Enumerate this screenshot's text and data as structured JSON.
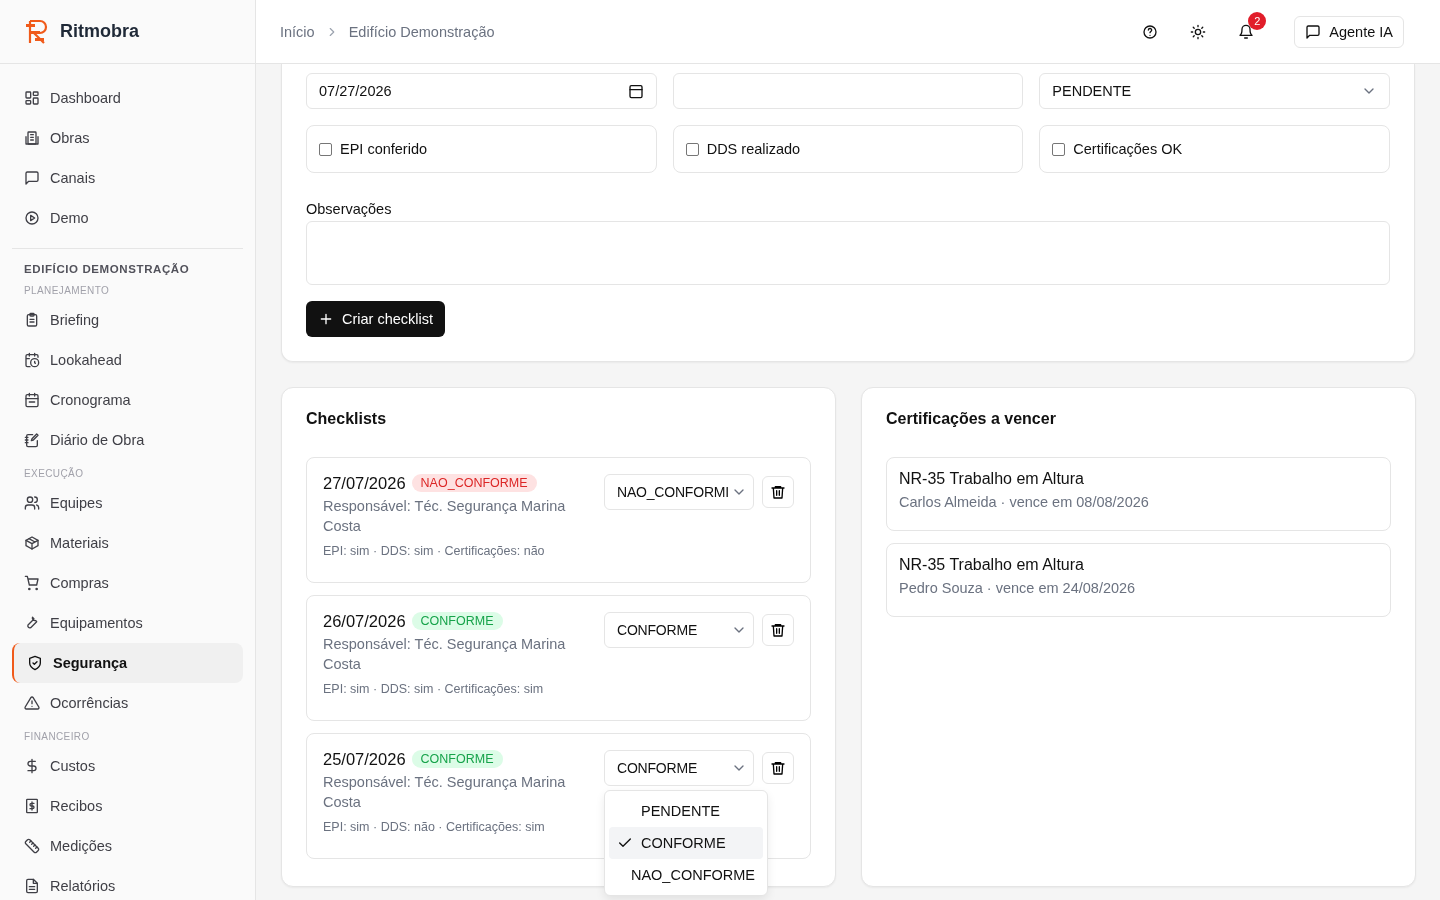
{
  "sidebar": {
    "logo": "Ritmobra",
    "items": [
      {
        "label": "Dashboard",
        "selected": false
      },
      {
        "label": "Obras",
        "selected": false
      },
      {
        "label": "Canais",
        "selected": false
      },
      {
        "label": "Demo",
        "selected": false
      }
    ],
    "project": "EDIFÍCIO DEMONSTRAÇÃO",
    "groups": [
      {
        "title": "PLANEJAMENTO",
        "items": [
          {
            "label": "Briefing",
            "selected": false
          },
          {
            "label": "Lookahead",
            "selected": false
          },
          {
            "label": "Cronograma",
            "selected": false
          },
          {
            "label": "Diário de Obra",
            "selected": false
          }
        ]
      },
      {
        "title": "EXECUÇÃO",
        "items": [
          {
            "label": "Equipes",
            "selected": false
          },
          {
            "label": "Materiais",
            "selected": false
          },
          {
            "label": "Compras",
            "selected": false
          },
          {
            "label": "Equipamentos",
            "selected": false
          },
          {
            "label": "Segurança",
            "selected": true
          },
          {
            "label": "Ocorrências",
            "selected": false
          }
        ]
      },
      {
        "title": "FINANCEIRO",
        "items": [
          {
            "label": "Custos",
            "selected": false
          },
          {
            "label": "Recibos",
            "selected": false
          },
          {
            "label": "Medições",
            "selected": false
          },
          {
            "label": "Relatórios",
            "selected": false
          }
        ]
      }
    ]
  },
  "header": {
    "breadcrumb": [
      "Início",
      "Edifício Demonstração"
    ],
    "notifications": "2",
    "agent_button": "Agente IA"
  },
  "form": {
    "date": "07/27/2026",
    "status": "PENDENTE",
    "checks": [
      {
        "label": "EPI conferido",
        "checked": false
      },
      {
        "label": "DDS realizado",
        "checked": false
      },
      {
        "label": "Certificações OK",
        "checked": false
      }
    ],
    "notes_label": "Observações",
    "submit": "Criar checklist"
  },
  "checklists": {
    "title": "Checklists",
    "items": [
      {
        "date": "27/07/2026",
        "badge": "NAO_CONFORME",
        "kind": "nao_conforme",
        "responsible": "Responsável: Téc. Segurança Marina Costa",
        "details": "EPI: sim · DDS: sim · Certificações: não",
        "select": "NAO_CONFORMI"
      },
      {
        "date": "26/07/2026",
        "badge": "CONFORME",
        "kind": "conforme",
        "responsible": "Responsável: Téc. Segurança Marina Costa",
        "details": "EPI: sim · DDS: sim · Certificações: sim",
        "select": "CONFORME"
      },
      {
        "date": "25/07/2026",
        "badge": "CONFORME",
        "kind": "conforme",
        "responsible": "Responsável: Téc. Segurança Marina Costa",
        "details": "EPI: sim · DDS: não · Certificações: sim",
        "select": "CONFORME",
        "dropdown": [
          {
            "label": "PENDENTE",
            "selected": false
          },
          {
            "label": "CONFORME",
            "selected": true
          },
          {
            "label": "NAO_CONFORME",
            "selected": false
          }
        ]
      }
    ]
  },
  "certifications": {
    "title": "Certificações a vencer",
    "items": [
      {
        "name": "NR-35 Trabalho em Altura",
        "meta": "Carlos Almeida · vence em 08/08/2026"
      },
      {
        "name": "NR-35 Trabalho em Altura",
        "meta": "Pedro Souza · vence em 24/08/2026"
      }
    ]
  }
}
